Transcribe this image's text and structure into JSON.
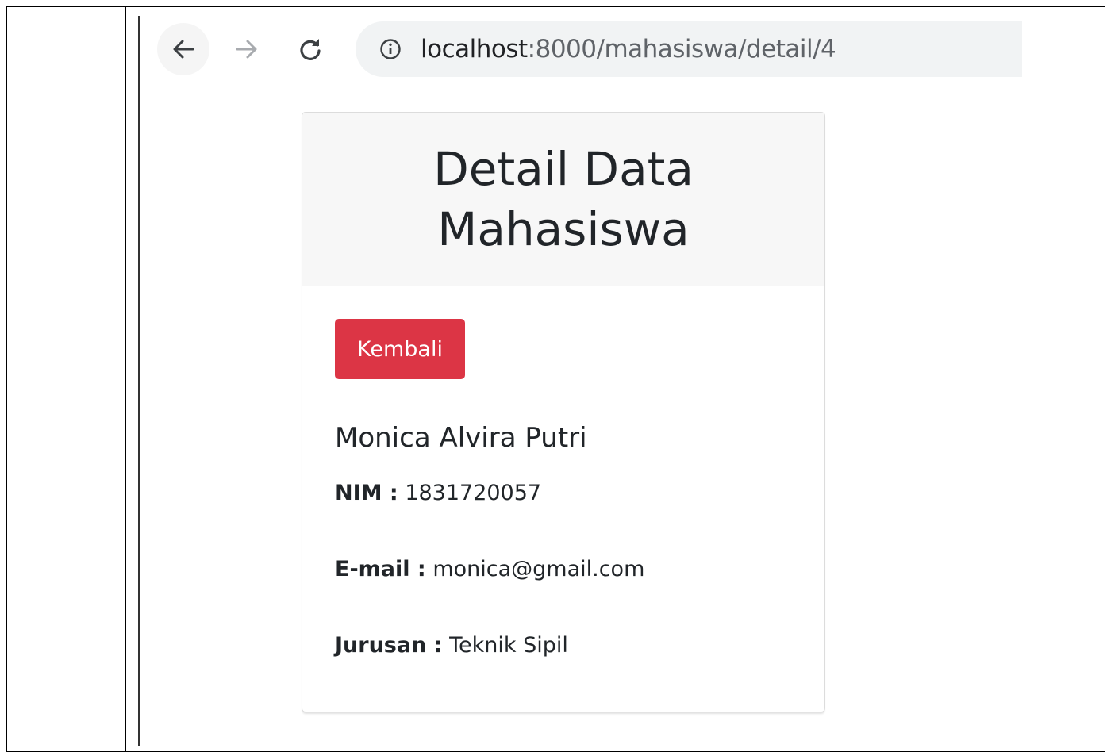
{
  "browser": {
    "url_host": "localhost",
    "url_rest": ":8000/mahasiswa/detail/4",
    "icons": {
      "back": "arrow-left-icon",
      "forward": "arrow-right-icon",
      "reload": "reload-icon",
      "info": "info-icon"
    }
  },
  "card": {
    "title": "Detail Data Mahasiswa",
    "back_button_label": "Kembali",
    "back_button_color": "#dc3545",
    "student_name": "Monica Alvira Putri",
    "fields": {
      "nim_label": "NIM :",
      "nim_value": "1831720057",
      "email_label": "E-mail :",
      "email_value": "monica@gmail.com",
      "jurusan_label": "Jurusan :",
      "jurusan_value": "Teknik Sipil"
    }
  }
}
